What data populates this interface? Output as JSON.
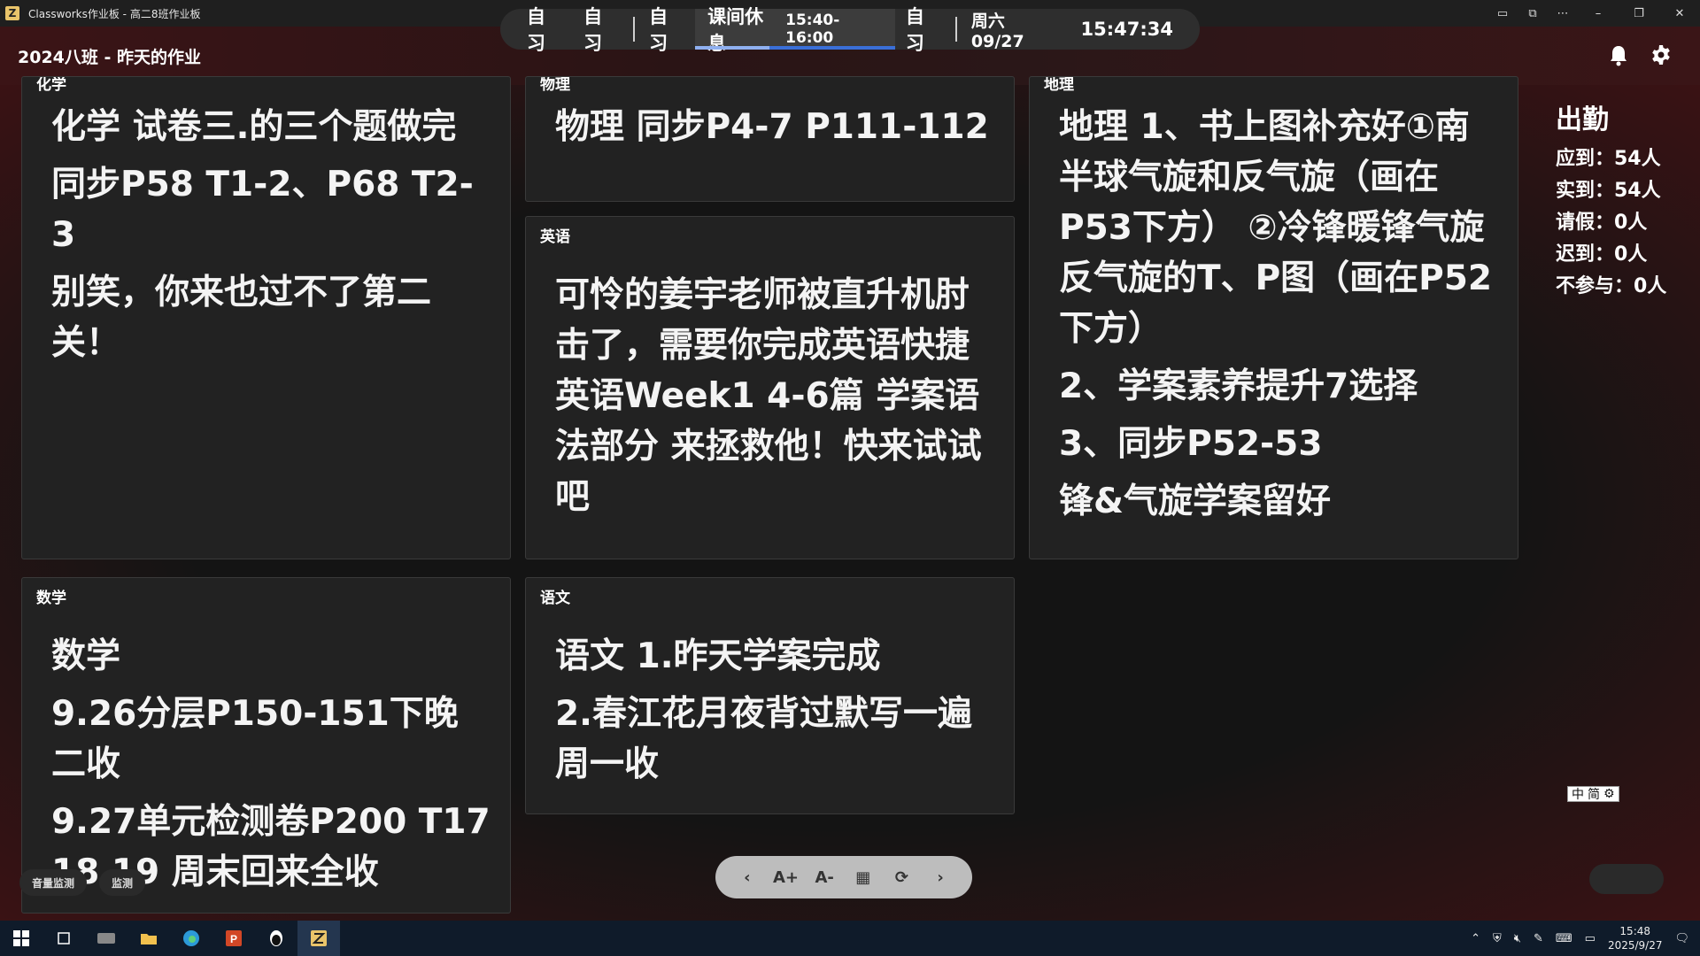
{
  "window": {
    "title": "Classworks作业板 - 高二8班作业板",
    "controls": [
      "minimize",
      "restore",
      "close"
    ]
  },
  "schedule": {
    "slots_before": [
      "自习",
      "自习"
    ],
    "slot_before_sep": "自习",
    "current": {
      "label": "课间休息",
      "time": "15:40-16:00",
      "progress": 0.37
    },
    "slot_after": "自习",
    "date": "周六 09/27",
    "clock": "15:47:34"
  },
  "header": {
    "title": "2024八班 - 昨天的作业",
    "bell_icon": "bell-icon",
    "gear_icon": "gear-icon"
  },
  "cards": [
    {
      "subject": "化学",
      "lines": [
        "化学 试卷三.的三个题做完",
        "同步P58 T1-2、P68 T2-3",
        "别笑，你来也过不了第二关！"
      ]
    },
    {
      "subject": "物理",
      "lines": [
        "物理 同步P4-7 P111-112"
      ]
    },
    {
      "subject": "地理",
      "lines": [
        "地理 1、书上图补充好①南半球气旋和反气旋（画在P53下方） ②冷锋暖锋气旋反气旋的T、P图（画在P52下方）",
        "2、学案素养提升7选择",
        "3、同步P52-53",
        "锋&气旋学案留好"
      ]
    },
    {
      "subject": "英语",
      "lines": [
        "可怜的姜宇老师被直升机肘击了，需要你完成英语快捷英语Week1 4-6篇 学案语法部分 来拯救他！快来试试吧"
      ]
    },
    {
      "subject": "数学",
      "lines": [
        "数学",
        "9.26分层P150-151下晚二收",
        "9.27单元检测卷P200 T17 18 19 周末回来全收"
      ]
    },
    {
      "subject": "语文",
      "lines": [
        "语文 1.昨天学案完成",
        "2.春江花月夜背过默写一遍周一收"
      ]
    }
  ],
  "attendance": {
    "title": "出勤",
    "should": "应到：54人",
    "actual": "实到：54人",
    "leave": "请假：0人",
    "late": "迟到：0人",
    "absent": "不参与：0人"
  },
  "toolbar_icons": [
    "chevron-left-icon",
    "font-increase-icon",
    "font-decrease-icon",
    "calendar-icon",
    "refresh-icon",
    "chevron-right-icon"
  ],
  "toolbar_glyphs": [
    "‹",
    "A+",
    "A-",
    "▦",
    "⟳",
    "›"
  ],
  "chips": {
    "volume": "音量监测",
    "monitor": "监测"
  },
  "ime": {
    "label": "中",
    "mode": "简"
  },
  "taskbar": {
    "time": "15:48",
    "date": "2025/9/27"
  },
  "colors": {
    "accent": "#3a6fd8",
    "header_bg": "#2a1415",
    "card_bg": "#222222"
  }
}
